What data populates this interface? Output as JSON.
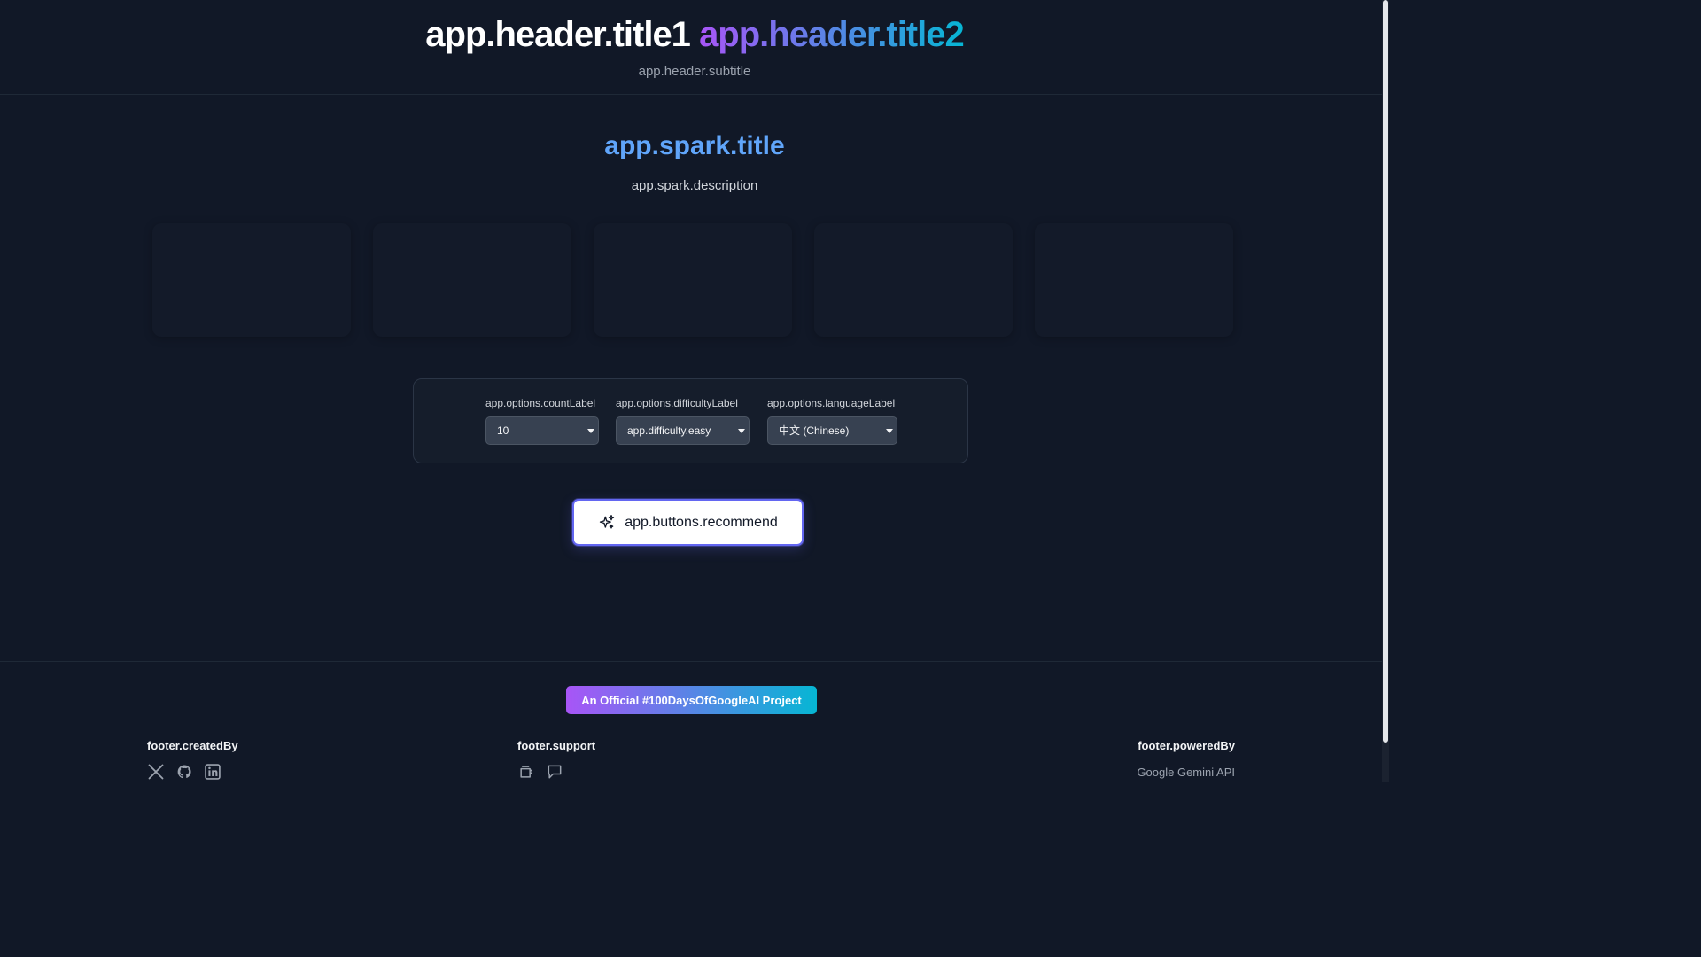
{
  "header": {
    "title1": "app.header.title1",
    "title2": "app.header.title2",
    "subtitle": "app.header.subtitle"
  },
  "spark": {
    "title": "app.spark.title",
    "description": "app.spark.description"
  },
  "options": {
    "count": {
      "label": "app.options.countLabel",
      "value": "10"
    },
    "difficulty": {
      "label": "app.options.difficultyLabel",
      "value": "app.difficulty.easy"
    },
    "language": {
      "label": "app.options.languageLabel",
      "value": "中文 (Chinese)"
    }
  },
  "buttons": {
    "recommend": "app.buttons.recommend",
    "recommend_icon": "sparkles-icon"
  },
  "footer": {
    "badge": "An Official #100DaysOfGoogleAI Project",
    "createdBy": "footer.createdBy",
    "support": "footer.support",
    "poweredBy": "footer.poweredBy",
    "poweredByValue": "Google Gemini API",
    "social_icons": [
      "x-icon",
      "github-icon",
      "linkedin-icon"
    ],
    "support_icons": [
      "coffee-cup-icon",
      "chat-icon"
    ]
  },
  "colors": {
    "background": "#111827",
    "accent_blue": "#60a5fa",
    "gradient_start": "#a855f7",
    "gradient_end": "#06b6d4",
    "button_border": "#6366f1"
  }
}
